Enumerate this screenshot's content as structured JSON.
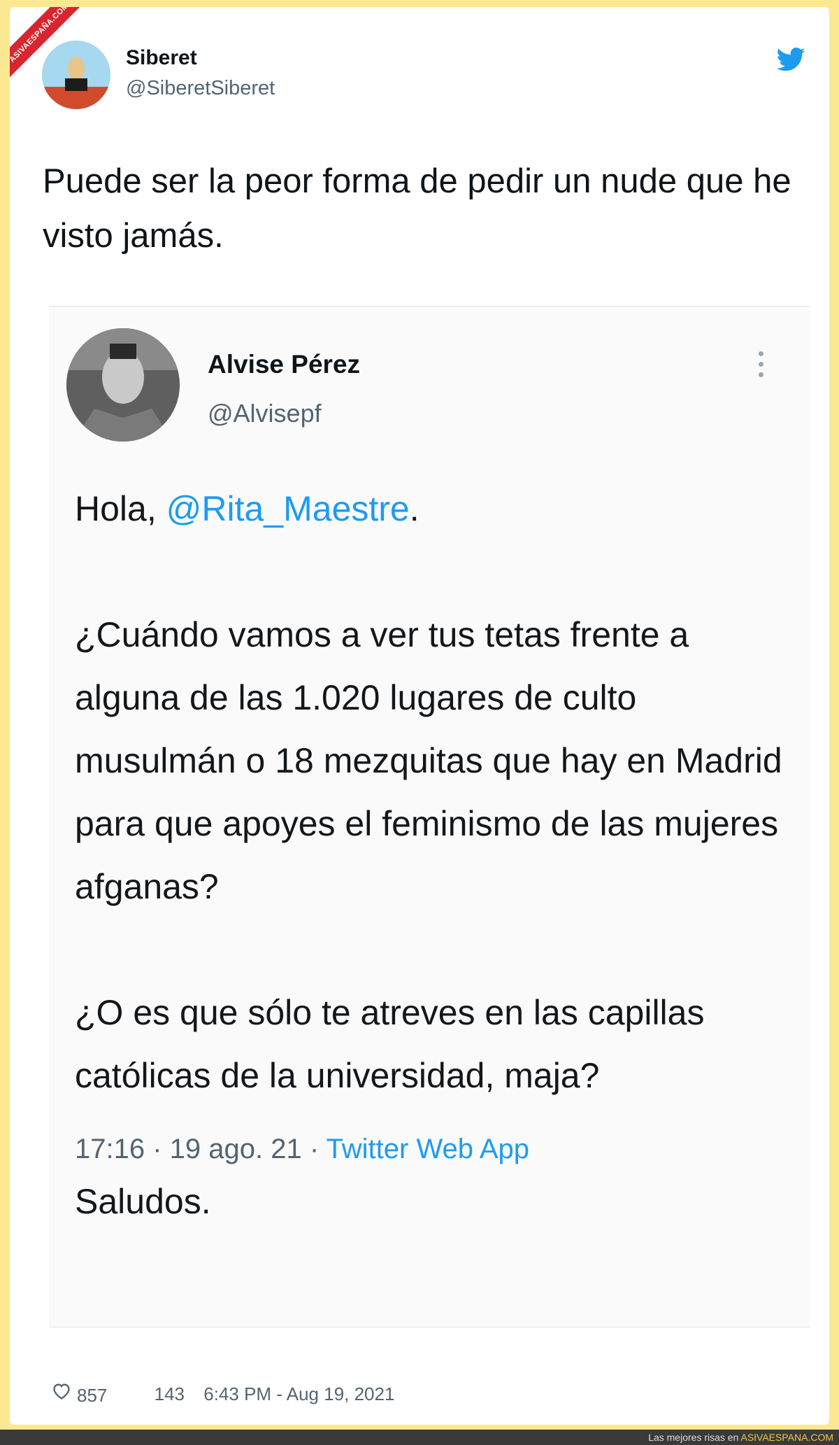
{
  "watermark": {
    "ribbon": "ASIVAESPAÑA.COM"
  },
  "tweet": {
    "author_name": "Siberet",
    "author_handle": "@SiberetSiberet",
    "text": "Puede ser la peor forma de pedir un nude que he visto jamás.",
    "likes": "857",
    "retweets": "143",
    "timestamp": "6:43 PM - Aug 19, 2021",
    "icons": [
      "twitter-bird-icon",
      "heart-icon"
    ]
  },
  "quoted": {
    "author_name": "Alvise Pérez",
    "author_handle": "@Alvisepf",
    "greeting": "Hola, ",
    "mention": "@Rita_Maestre",
    "greeting_end": ".",
    "para1": "¿Cuándo vamos a ver tus tetas frente a alguna de las 1.020 lugares de culto musulmán o 18 mezquitas que hay en Madrid para que apoyes el feminismo de las mujeres afganas?",
    "para2": "¿O es que sólo te atreves en las capillas católicas de la universidad, maja?",
    "closing": "Saludos.",
    "meta_time": "17:16 · 19 ago. 21 · ",
    "meta_source": "Twitter Web App",
    "icons": [
      "more-options-icon"
    ]
  },
  "bottom_bar": {
    "prefix": "Las mejores risas en ",
    "site": "ASIVAESPANA.COM"
  },
  "colors": {
    "frame": "#fbe891",
    "link": "#1d9bf0",
    "ribbon": "#d7262f"
  }
}
